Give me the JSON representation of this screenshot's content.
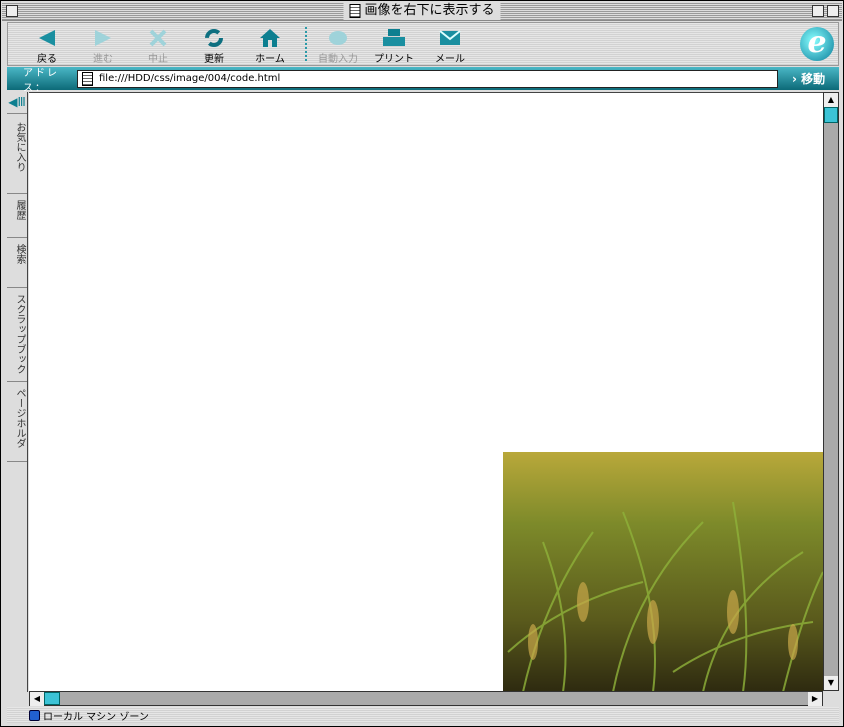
{
  "window": {
    "title": "画像を右下に表示する"
  },
  "toolbar": {
    "back": "戻る",
    "forward": "進む",
    "stop": "中止",
    "refresh": "更新",
    "home": "ホーム",
    "autofill": "自動入力",
    "print": "プリント",
    "mail": "メール"
  },
  "address": {
    "label": "アドレス：",
    "url": "file:///HDD/css/image/004/code.html",
    "go": "移動"
  },
  "sidebar": {
    "tabs": [
      "お気に入り",
      "履歴",
      "検索",
      "スクラップブック",
      "ページホルダ"
    ]
  },
  "status": {
    "zone": "ローカル マシン ゾーン"
  },
  "colors": {
    "accent": "#1a8fa0"
  }
}
